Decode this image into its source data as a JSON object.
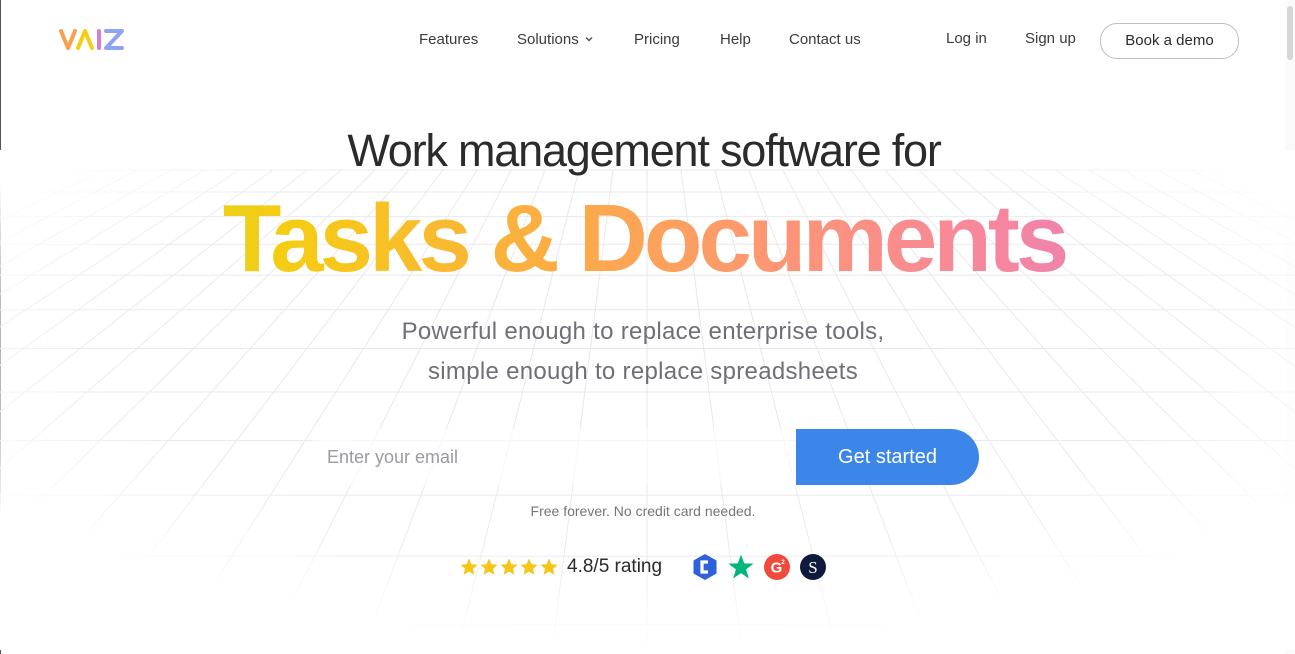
{
  "brand": {
    "name": "VAIZ",
    "logo_colors": [
      "#f7a14e",
      "#f5cd12",
      "#d57cd3",
      "#8fa3f5"
    ]
  },
  "nav": {
    "items": [
      {
        "label": "Features"
      },
      {
        "label": "Solutions",
        "has_dropdown": true
      },
      {
        "label": "Pricing"
      },
      {
        "label": "Help"
      },
      {
        "label": "Contact us"
      }
    ],
    "login_label": "Log in",
    "signup_label": "Sign up",
    "demo_label": "Book a demo"
  },
  "hero": {
    "line1": "Work management software for",
    "line2": "Tasks & Documents",
    "gradient_colors": [
      "#c7d630",
      "#f5cd12",
      "#fbae42",
      "#fd9674",
      "#f685a0",
      "#d57cd3"
    ],
    "subtitle_line1": "Powerful enough to replace enterprise tools,",
    "subtitle_line2": "simple enough to replace spreadsheets"
  },
  "signup_form": {
    "email_placeholder": "Enter your email",
    "email_value": "",
    "submit_label": "Get started",
    "submit_color": "#3b86e8",
    "note": "Free forever. No credit card needed."
  },
  "rating": {
    "stars": 5,
    "star_color": "#f5c518",
    "text": "4.8/5 rating",
    "review_sites": [
      {
        "icon": "capterra-badge-icon",
        "color": "#2f61d8"
      },
      {
        "icon": "trustpilot-star-icon",
        "color": "#00b67a"
      },
      {
        "icon": "g2-badge-icon",
        "color": "#ef4a3c"
      },
      {
        "icon": "sourceforge-badge-icon",
        "color": "#0f1a3c"
      }
    ]
  }
}
